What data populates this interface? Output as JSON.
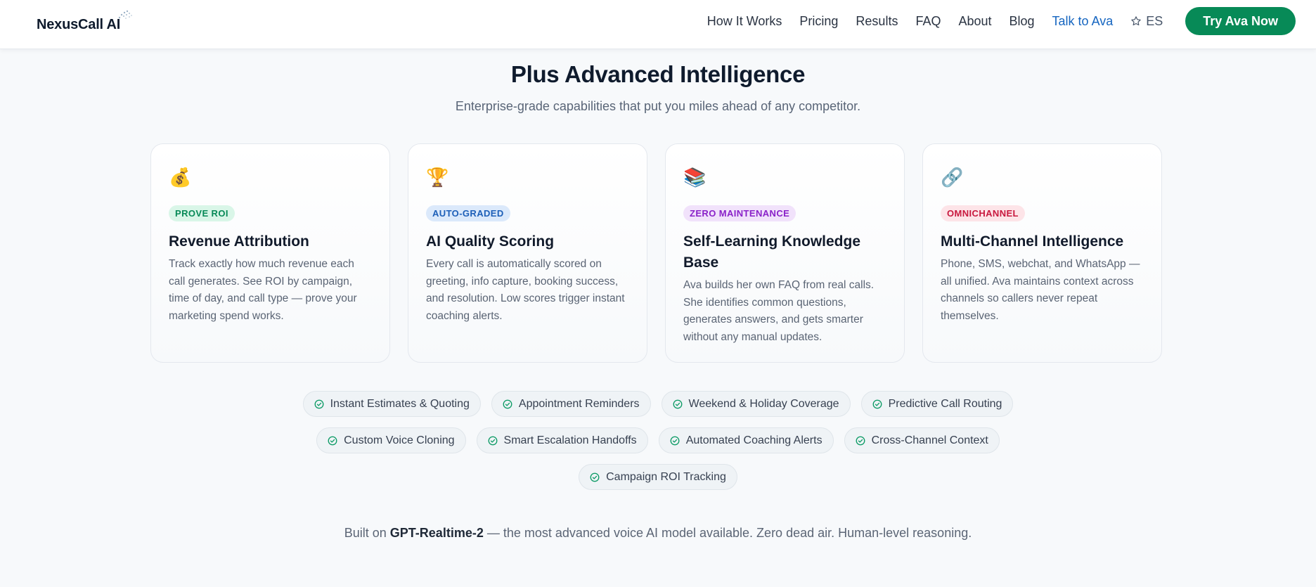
{
  "brand": {
    "name": "NexusCall AI"
  },
  "nav": {
    "links": [
      {
        "label": "How It Works"
      },
      {
        "label": "Pricing"
      },
      {
        "label": "Results"
      },
      {
        "label": "FAQ"
      },
      {
        "label": "About"
      },
      {
        "label": "Blog"
      },
      {
        "label": "Talk to Ava"
      }
    ],
    "lang": "ES",
    "cta": "Try Ava Now"
  },
  "section": {
    "title": "Plus Advanced Intelligence",
    "subtitle": "Enterprise-grade capabilities that put you miles ahead of any competitor."
  },
  "cards": [
    {
      "icon": "money-bag-icon",
      "emoji": "💰",
      "badge": "PROVE ROI",
      "title": "Revenue Attribution",
      "description": "Track exactly how much revenue each call generates. See ROI by campaign, time of day, and call type — prove your marketing spend works."
    },
    {
      "icon": "trophy-icon",
      "emoji": "🏆",
      "badge": "AUTO-GRADED",
      "title": "AI Quality Scoring",
      "description": "Every call is automatically scored on greeting, info capture, booking success, and resolution. Low scores trigger instant coaching alerts."
    },
    {
      "icon": "books-icon",
      "emoji": "📚",
      "badge": "ZERO MAINTENANCE",
      "title": "Self-Learning Knowledge Base",
      "description": "Ava builds her own FAQ from real calls. She identifies common questions, generates answers, and gets smarter without any manual updates."
    },
    {
      "icon": "link-icon",
      "emoji": "🔗",
      "badge": "OMNICHANNEL",
      "title": "Multi-Channel Intelligence",
      "description": "Phone, SMS, webchat, and WhatsApp — all unified. Ava maintains context across channels so callers never repeat themselves."
    }
  ],
  "chips": [
    [
      "Instant Estimates & Quoting",
      "Appointment Reminders",
      "Weekend & Holiday Coverage",
      "Predictive Call Routing"
    ],
    [
      "Custom Voice Cloning",
      "Smart Escalation Handoffs",
      "Automated Coaching Alerts",
      "Cross-Channel Context"
    ],
    [
      "Campaign ROI Tracking"
    ]
  ],
  "footer": {
    "prefix": "Built on ",
    "model": "GPT-Realtime-2",
    "suffix": " — the most advanced voice AI model available. Zero dead air. Human-level reasoning."
  },
  "colors": {
    "brand_green": "#078a57",
    "link_blue": "#1565c0",
    "badge_green_bg": "#d9f6e8",
    "badge_green_fg": "#078a57",
    "badge_blue_bg": "#dbe9fb",
    "badge_blue_fg": "#1d5fb8",
    "badge_purple_bg": "#f1e2fb",
    "badge_purple_fg": "#8a22c9",
    "badge_red_bg": "#fde4e8",
    "badge_red_fg": "#c8183e"
  }
}
